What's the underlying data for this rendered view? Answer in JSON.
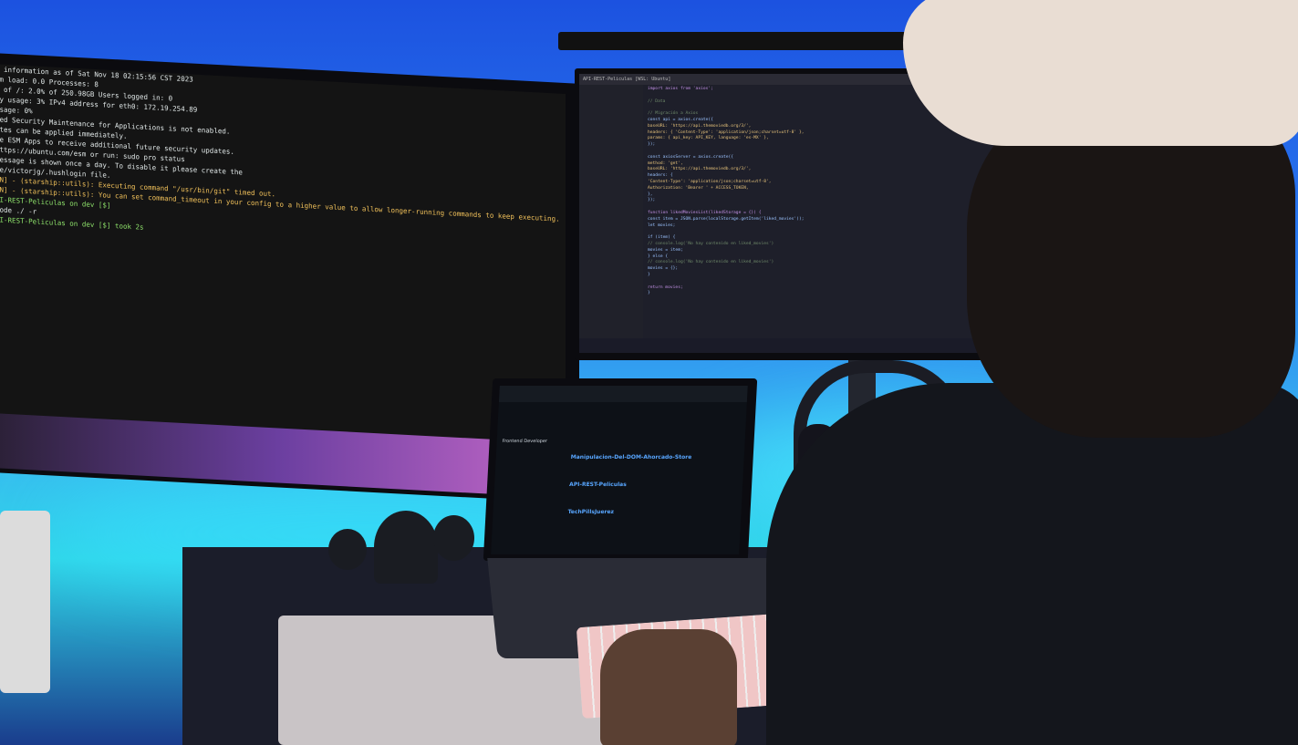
{
  "terminal": {
    "lines": [
      "m information as of Sat Nov 18 02:15:56 CST 2023",
      "",
      "em load:  0.0                   Processes:              8",
      "e of /:   2.0% of 250.98GB     Users logged in:        0",
      "ry usage:  3%                  IPv4 address for eth0: 172.19.254.89",
      "  usage:   0%",
      "",
      "ded Security Maintenance for Applications is not enabled.",
      "",
      "ates can be applied immediately.",
      "",
      "le ESM Apps to receive additional future security updates.",
      "https://ubuntu.com/esm or run: sudo pro status",
      "",
      "",
      " message is shown once a day. To disable it please create the",
      "me/victorjg/.hushlogin file.",
      "RN] - (starship::utils): Executing command \"/usr/bin/git\" timed out.",
      "RN] - (starship::utils): You can set command_timeout in your config to a higher value to allow longer-running commands to keep executing.",
      "",
      "PI-REST-Peliculas on  dev [$]",
      " code ./ -r",
      "",
      "PI-REST-Peliculas on  dev [$] took 2s"
    ]
  },
  "vscode": {
    "title": "API-REST-Peliculas [WSL: Ubuntu]",
    "code": [
      "import axios from 'axios';",
      "",
      "// Data",
      "",
      "// Migración a Axios",
      "const api = axios.create({",
      "  baseURL: 'https://api.themoviedb.org/3/',",
      "  headers: { 'Content-Type': 'application/json;charset=utf-8' },",
      "  params: { api_key: API_KEY, language: 'es-MX' },",
      "});",
      "",
      "const axiosServer = axios.create({",
      "  method: 'get',",
      "  baseURL: 'https://api.themoviedb.org/3/',",
      "  headers: {",
      "    'Content-Type': 'application/json;charset=utf-8',",
      "    Authorization: 'Bearer ' + ACCESS_TOKEN,",
      "  },",
      "});",
      "",
      "function likedMoviesList(likedStorage = {}) {",
      "  const item = JSON.parse(localStorage.getItem('liked_movies'));",
      "  let movies;",
      "",
      "  if (item) {",
      "    // console.log('No hay contenido en liked_movies')",
      "    movies = item;",
      "  } else {",
      "    // console.log('No hay contenido en liked_movies')",
      "    movies = {};",
      "  }",
      "",
      "  return movies;",
      "}"
    ]
  },
  "laptop": {
    "sections": [
      "Frontend Developer",
      "Manipulacion-Del-DOM-Ahorcado-Store",
      "API-REST-Peliculas",
      "TechPillsJuerez"
    ]
  }
}
